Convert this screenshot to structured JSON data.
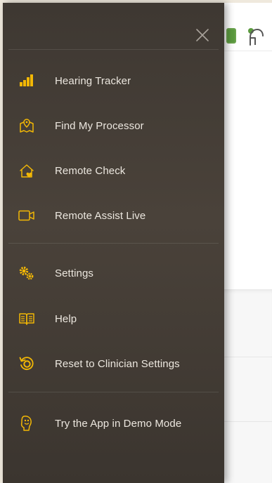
{
  "menu": {
    "close_icon": "close-icon",
    "items": [
      {
        "label": "Hearing Tracker",
        "icon": "signal-bars-icon"
      },
      {
        "label": "Find My Processor",
        "icon": "map-pin-icon"
      },
      {
        "label": "Remote Check",
        "icon": "house-heart-icon"
      },
      {
        "label": "Remote Assist Live",
        "icon": "video-camera-icon"
      },
      {
        "label": "Settings",
        "icon": "gears-icon"
      },
      {
        "label": "Help",
        "icon": "book-icon"
      },
      {
        "label": "Reset to Clinician Settings",
        "icon": "reset-icon"
      },
      {
        "label": "Try the App in Demo Mode",
        "icon": "demo-device-icon"
      }
    ]
  },
  "colors": {
    "drawer_bg": "#443d36",
    "accent_yellow": "#f2b705",
    "text": "#ece7df",
    "battery_green": "#5b9a3f"
  }
}
